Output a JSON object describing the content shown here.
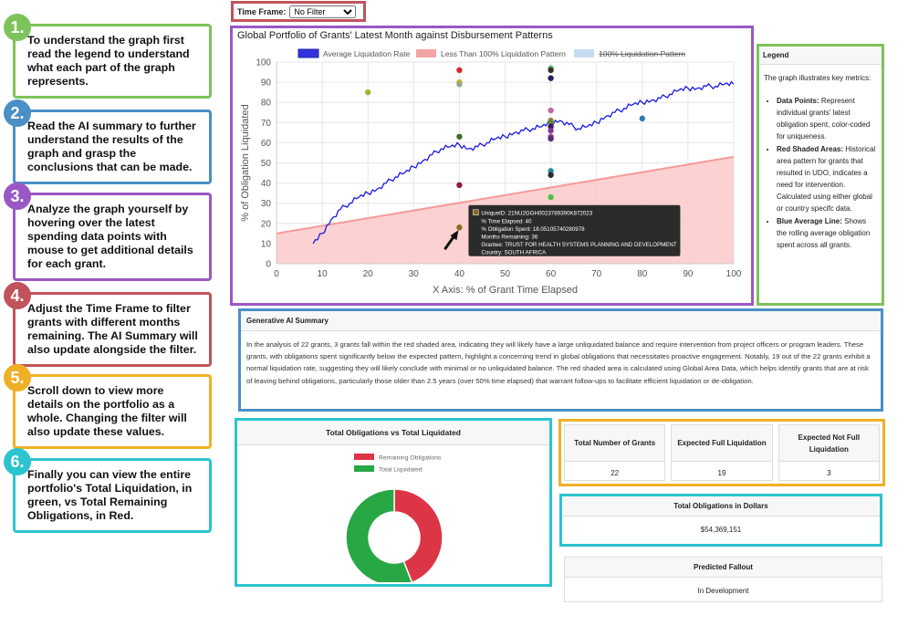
{
  "steps": [
    {
      "num": "1.",
      "text": "To understand the graph first read the legend to understand what each part of the graph represents."
    },
    {
      "num": "2.",
      "text": "Read the AI summary to further understand the results of the graph and grasp the conclusions that can be made."
    },
    {
      "num": "3.",
      "text": "Analyze the graph yourself by hovering over the latest spending data points with mouse to get additional details for each grant."
    },
    {
      "num": "4.",
      "text": "Adjust the Time Frame to filter grants with different months remaining. The AI Summary will also update alongside the filter."
    },
    {
      "num": "5.",
      "text": "Scroll down to view more details on the portfolio as a whole. Changing the filter will also update these values."
    },
    {
      "num": "6.",
      "text": "Finally you can view the entire portfolio's Total Liquidation, in green, vs Total Remaining Obligations, in Red."
    }
  ],
  "timeframe": {
    "label": "Time Frame:",
    "selected": "No Filter"
  },
  "chart_title": "Global Portfolio of Grants' Latest Month against Disbursement Patterns",
  "chart_data": {
    "type": "scatter",
    "xlabel": "X Axis: % of Grant Time Elapsed",
    "ylabel": "% of Obligation Liquidated",
    "xlim": [
      0,
      100
    ],
    "ylim": [
      0,
      100
    ],
    "xticks": [
      "0",
      "10",
      "20",
      "30",
      "40",
      "50",
      "60",
      "70",
      "80",
      "90",
      "100"
    ],
    "yticks": [
      "0",
      "10",
      "20",
      "30",
      "40",
      "50",
      "60",
      "70",
      "80",
      "90",
      "100"
    ],
    "grid": true,
    "legend_position": "top",
    "legend": [
      {
        "label": "Average Liquidation Rate",
        "color": "#3333dd"
      },
      {
        "label": "Less Than 100% Liquidation Pattern",
        "color": "#f4a4a4"
      },
      {
        "label": "100% Liquidation Pattern",
        "color": "#c6dbf2",
        "struck": true
      }
    ],
    "red_area_line": [
      [
        0,
        15
      ],
      [
        100,
        53
      ]
    ],
    "average_line": [
      [
        8,
        10
      ],
      [
        10,
        15
      ],
      [
        12,
        22
      ],
      [
        14,
        27
      ],
      [
        16,
        30
      ],
      [
        18,
        33
      ],
      [
        20,
        35
      ],
      [
        22,
        37
      ],
      [
        24,
        40
      ],
      [
        26,
        43
      ],
      [
        28,
        45
      ],
      [
        30,
        48
      ],
      [
        32,
        51
      ],
      [
        34,
        54
      ],
      [
        36,
        57
      ],
      [
        38,
        58
      ],
      [
        40,
        59
      ],
      [
        42,
        57
      ],
      [
        44,
        58
      ],
      [
        46,
        60
      ],
      [
        48,
        62
      ],
      [
        50,
        63
      ],
      [
        52,
        65
      ],
      [
        54,
        66
      ],
      [
        56,
        67
      ],
      [
        58,
        68
      ],
      [
        60,
        70
      ],
      [
        62,
        71
      ],
      [
        64,
        69
      ],
      [
        66,
        67
      ],
      [
        68,
        68
      ],
      [
        70,
        70
      ],
      [
        72,
        73
      ],
      [
        74,
        75
      ],
      [
        76,
        77
      ],
      [
        78,
        79
      ],
      [
        80,
        80
      ],
      [
        82,
        81
      ],
      [
        84,
        82
      ],
      [
        86,
        84
      ],
      [
        88,
        86
      ],
      [
        90,
        87
      ],
      [
        92,
        87
      ],
      [
        94,
        88
      ],
      [
        96,
        88
      ],
      [
        98,
        89
      ],
      [
        100,
        89
      ]
    ],
    "points": [
      {
        "x": 20,
        "y": 85,
        "color": "#9ab52a"
      },
      {
        "x": 40,
        "y": 96,
        "color": "#d62a2a"
      },
      {
        "x": 40,
        "y": 90,
        "color": "#c8b430"
      },
      {
        "x": 40,
        "y": 89,
        "color": "#9aa48a"
      },
      {
        "x": 40,
        "y": 63,
        "color": "#3c6a2e"
      },
      {
        "x": 40,
        "y": 39,
        "color": "#8a1e3c"
      },
      {
        "x": 40,
        "y": 18,
        "color": "#8a6a1e"
      },
      {
        "x": 60,
        "y": 97,
        "color": "#6ac26a"
      },
      {
        "x": 60,
        "y": 96,
        "color": "#3a2a2a"
      },
      {
        "x": 60,
        "y": 92,
        "color": "#222266"
      },
      {
        "x": 60,
        "y": 76,
        "color": "#c06aa0"
      },
      {
        "x": 60,
        "y": 71,
        "color": "#a07a3a"
      },
      {
        "x": 60,
        "y": 70,
        "color": "#6a8a2e"
      },
      {
        "x": 60,
        "y": 68,
        "color": "#3a1a5a"
      },
      {
        "x": 60,
        "y": 66,
        "color": "#7a3a9a"
      },
      {
        "x": 60,
        "y": 63,
        "color": "#9a3a8a"
      },
      {
        "x": 60,
        "y": 62,
        "color": "#5a2a7a"
      },
      {
        "x": 60,
        "y": 46,
        "color": "#2a8aa0"
      },
      {
        "x": 60,
        "y": 44,
        "color": "#2a2a2a"
      },
      {
        "x": 60,
        "y": 33,
        "color": "#4ac24a"
      },
      {
        "x": 80,
        "y": 72,
        "color": "#2a7ab0"
      }
    ],
    "tooltip": {
      "lines": [
        "UniqueID: 21NU2GGH0023789390K872023",
        "% Time Elapsed: 40",
        "% Obligation Spent: 18.05105740280978",
        "Months Remaining: 36",
        "Grantee: TRUST FOR HEALTH SYSTEMS PLANNING AND DEVELOPMENT",
        "Country: SOUTH AFRICA"
      ]
    }
  },
  "legend_panel": {
    "title": "Legend",
    "intro": "The graph illustrates key metrics:",
    "items": [
      {
        "term": "Data Points:",
        "desc": "Represent individual grants' latest obligation spent, color-coded for uniqueness."
      },
      {
        "term": "Red Shaded Areas:",
        "desc": "Historical area pattern for grants that resulted in UDO, indicates a need for intervention. Calculated using either global or country specifc data."
      },
      {
        "term": "Blue Average Line:",
        "desc": "Shows the rolling average obligation spent across all grants."
      }
    ]
  },
  "ai_summary": {
    "title": "Generative AI Summary",
    "text": "In the analysis of 22 grants, 3 grants fall within the red shaded area, indicating they will likely have a large unliquidated balance and require intervention from project officers or program leaders. These grants, with obligations spent significantly below the expected pattern, highlight a concerning trend in global obligations that necessitates proactive engagement. Notably, 19 out of the 22 grants exhibit a normal liquidation rate, suggesting they will likely conclude with minimal or no unliquidated balance. The red shaded area is calculated using Global Area Data, which helps identify grants that are at risk of leaving behind obligations, particularly those older than 2.5 years (over 50% time elapsed) that warrant follow-ups to facilitate efficient liquidation or de-obligation."
  },
  "donut": {
    "title": "Total Obligations vs Total Liquidated",
    "legend": [
      {
        "label": "Remaining Obligations",
        "color": "#dc3545"
      },
      {
        "label": "Total Liquidated",
        "color": "#28a745"
      }
    ],
    "chart_data": {
      "type": "pie",
      "categories": [
        "Remaining Obligations",
        "Total Liquidated"
      ],
      "values": [
        44,
        56
      ]
    }
  },
  "stats": [
    {
      "title": "Total Number of Grants",
      "value": "22"
    },
    {
      "title": "Expected Full Liquidation",
      "value": "19"
    },
    {
      "title": "Expected Not Full Liquidation",
      "value": "3"
    }
  ],
  "dollars": {
    "title": "Total Obligations in Dollars",
    "value": "$54,369,151"
  },
  "fallout": {
    "title": "Predicted Fallout",
    "value": "In Development"
  }
}
